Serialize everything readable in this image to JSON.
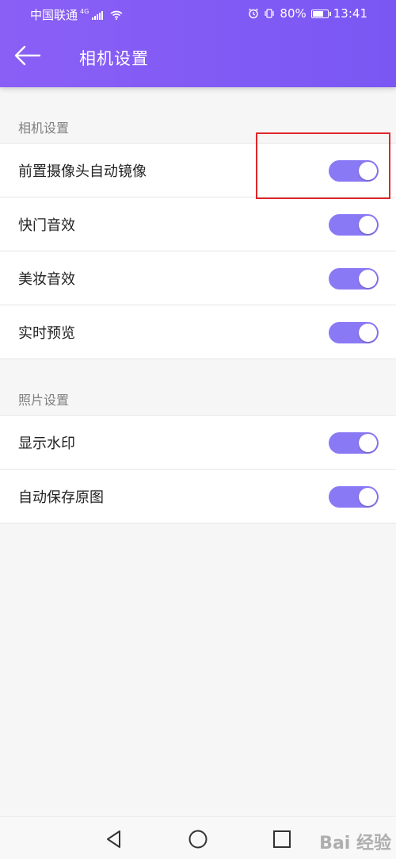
{
  "status_bar": {
    "carrier": "中国联通",
    "network": "4G",
    "battery": "80%",
    "battery_level": 0.8,
    "time": "13:41"
  },
  "header": {
    "title": "相机设置"
  },
  "sections": [
    {
      "label": "相机设置",
      "items": [
        {
          "label": "前置摄像头自动镜像",
          "enabled": true
        },
        {
          "label": "快门音效",
          "enabled": true
        },
        {
          "label": "美妆音效",
          "enabled": true
        },
        {
          "label": "实时预览",
          "enabled": true
        }
      ]
    },
    {
      "label": "照片设置",
      "items": [
        {
          "label": "显示水印",
          "enabled": true
        },
        {
          "label": "自动保存原图",
          "enabled": true
        }
      ]
    }
  ],
  "colors": {
    "accent": "#8a5ff6",
    "toggle_on": "#8a79f5",
    "annotation": "#e0262a"
  },
  "watermark": "Bai 经验"
}
